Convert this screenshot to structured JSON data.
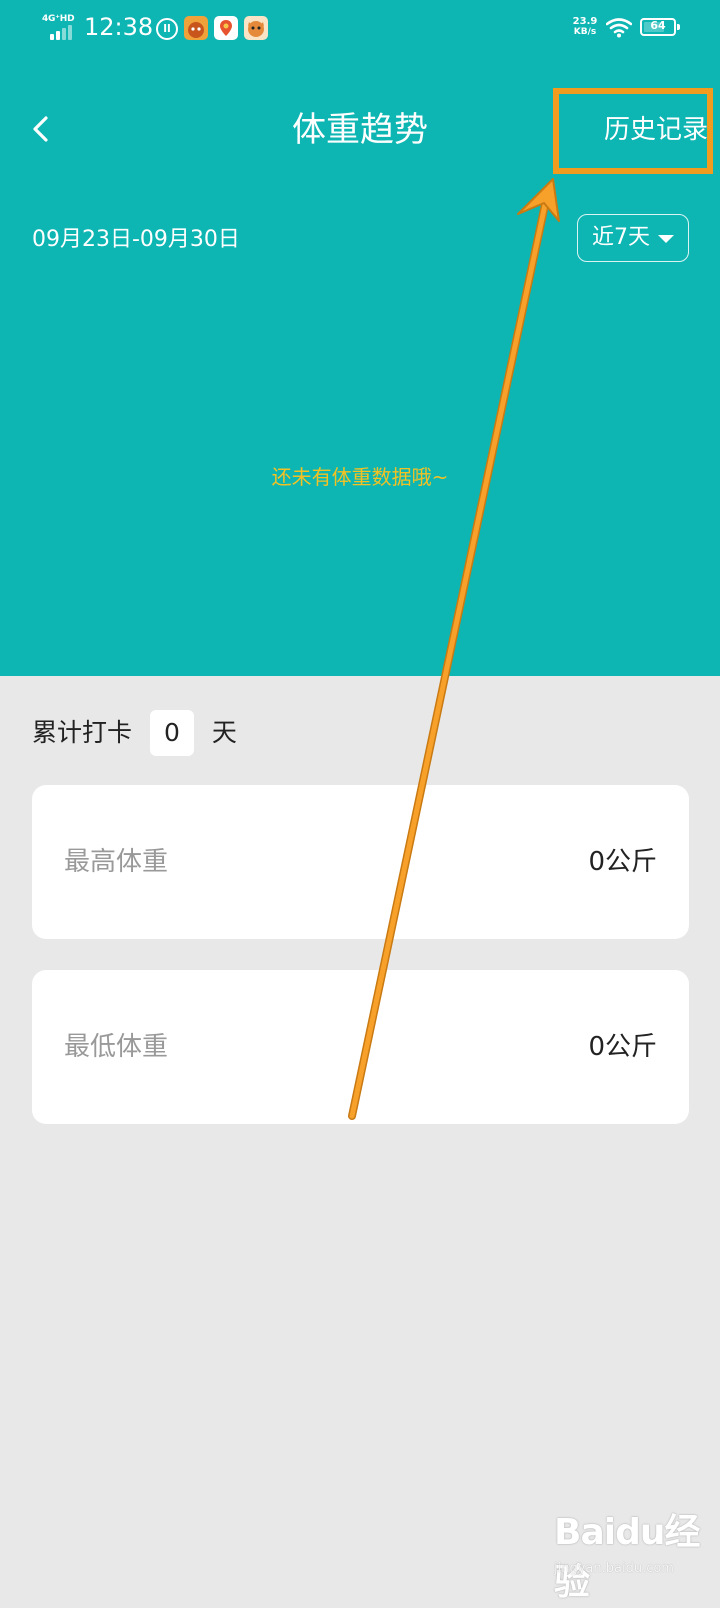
{
  "status_bar": {
    "network": "4G⁺HD",
    "time": "12:38",
    "net_speed_value": "23.9",
    "net_speed_unit": "KB/s",
    "battery": "64",
    "app_icons": [
      "ll-icon",
      "cartoon-app-icon",
      "map-pin-app-icon",
      "cat-app-icon"
    ]
  },
  "header": {
    "back_icon": "chevron-left-icon",
    "title": "体重趋势",
    "history_label": "历史记录"
  },
  "filter": {
    "date_range": "09月23日-09月30日",
    "period_selected": "近7天"
  },
  "chart": {
    "empty_message": "还未有体重数据哦~"
  },
  "checkin": {
    "prefix": "累计打卡",
    "count": "0",
    "suffix": "天"
  },
  "stats": [
    {
      "label": "最高体重",
      "value": "0公斤"
    },
    {
      "label": "最低体重",
      "value": "0公斤"
    }
  ],
  "watermark": {
    "brand": "Baidu经验",
    "url": "jingyan.baidu.com"
  },
  "colors": {
    "header_bg": "#0db6b3",
    "page_bg": "#e8e8e8",
    "annotation": "#f29c1f",
    "empty_text": "#f2c224"
  }
}
